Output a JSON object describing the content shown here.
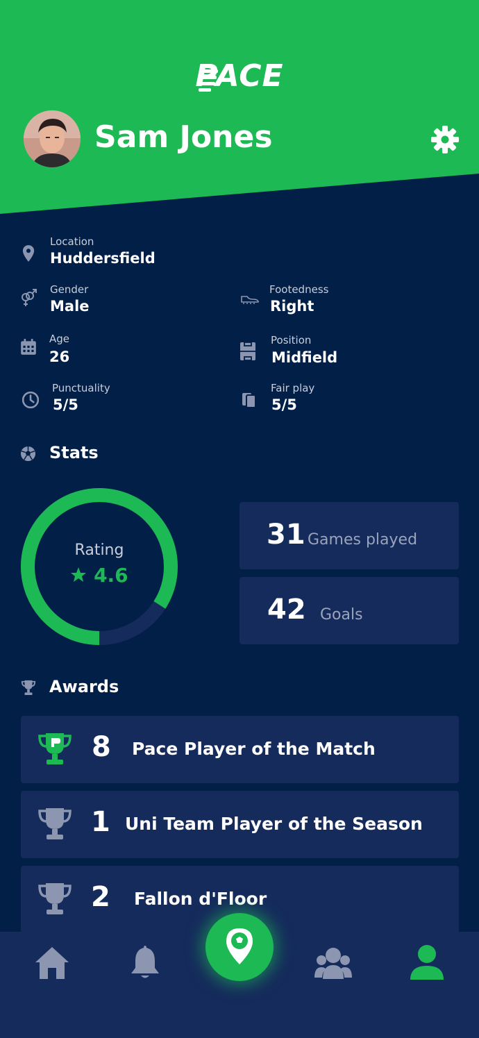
{
  "app": {
    "logo_text": "PACE"
  },
  "profile": {
    "name": "Sam Jones"
  },
  "info": {
    "location": {
      "label": "Location",
      "value": "Huddersfield",
      "icon": "map-pin-icon"
    },
    "gender": {
      "label": "Gender",
      "value": "Male",
      "icon": "gender-icon"
    },
    "footedness": {
      "label": "Footedness",
      "value": "Right",
      "icon": "football-boot-icon"
    },
    "age": {
      "label": "Age",
      "value": "26",
      "icon": "calendar-icon"
    },
    "position": {
      "label": "Position",
      "value": "Midfield",
      "icon": "pitch-icon"
    },
    "punctuality": {
      "label": "Punctuality",
      "value": "5/5",
      "icon": "clock-icon"
    },
    "fair_play": {
      "label": "Fair play",
      "value": "5/5",
      "icon": "cards-icon"
    }
  },
  "stats": {
    "title": "Stats",
    "rating_label": "Rating",
    "rating_value": "4.6",
    "rating_fraction": 0.84,
    "cards": [
      {
        "number": "31",
        "label": "Games played"
      },
      {
        "number": "42",
        "label": "Goals"
      }
    ]
  },
  "awards": {
    "title": "Awards",
    "items": [
      {
        "count": "8",
        "name": "Pace Player of the Match",
        "icon": "pace-trophy-icon"
      },
      {
        "count": "1",
        "name": "Uni Team Player of the Season",
        "icon": "trophy-icon"
      },
      {
        "count": "2",
        "name": "Fallon d'Floor",
        "icon": "trophy-icon"
      }
    ]
  },
  "nav": {
    "items": [
      "home-icon",
      "bell-icon",
      "map-football-icon",
      "team-icon",
      "profile-icon"
    ],
    "active": "profile-icon"
  },
  "colors": {
    "brand_green": "#1DB954",
    "navy": "#011F47",
    "card": "#152B5C",
    "icon_gray": "#8C96B0"
  }
}
